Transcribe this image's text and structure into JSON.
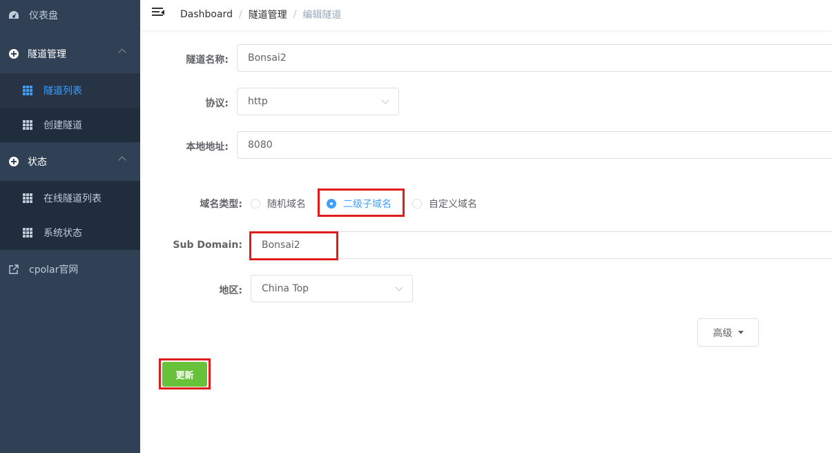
{
  "sidebar": {
    "dashboard": "仪表盘",
    "tunnel_mgmt": "隧道管理",
    "tunnel_list": "隧道列表",
    "create_tunnel": "创建隧道",
    "status": "状态",
    "online_tunnels": "在线隧道列表",
    "system_status": "系统状态",
    "cpolar_site": "cpolar官网"
  },
  "breadcrumb": {
    "home": "Dashboard",
    "section": "隧道管理",
    "current": "编辑隧道",
    "separator": "/"
  },
  "form": {
    "name_label": "隧道名称:",
    "name_value": "Bonsai2",
    "protocol_label": "协议:",
    "protocol_value": "http",
    "local_addr_label": "本地地址:",
    "local_addr_value": "8080",
    "domain_type_label": "域名类型:",
    "domain_types": [
      "随机域名",
      "二级子域名",
      "自定义域名"
    ],
    "domain_type_selected": "二级子域名",
    "subdomain_label": "Sub Domain:",
    "subdomain_value": "Bonsai2",
    "region_label": "地区:",
    "region_value": "China Top",
    "advanced_label": "高级",
    "update_label": "更新"
  },
  "colors": {
    "sidebar_bg": "#304156",
    "submenu_bg": "#1f2d3d",
    "active_color": "#409eff",
    "update_button": "#67c23a",
    "highlight": "#e01b1b"
  }
}
